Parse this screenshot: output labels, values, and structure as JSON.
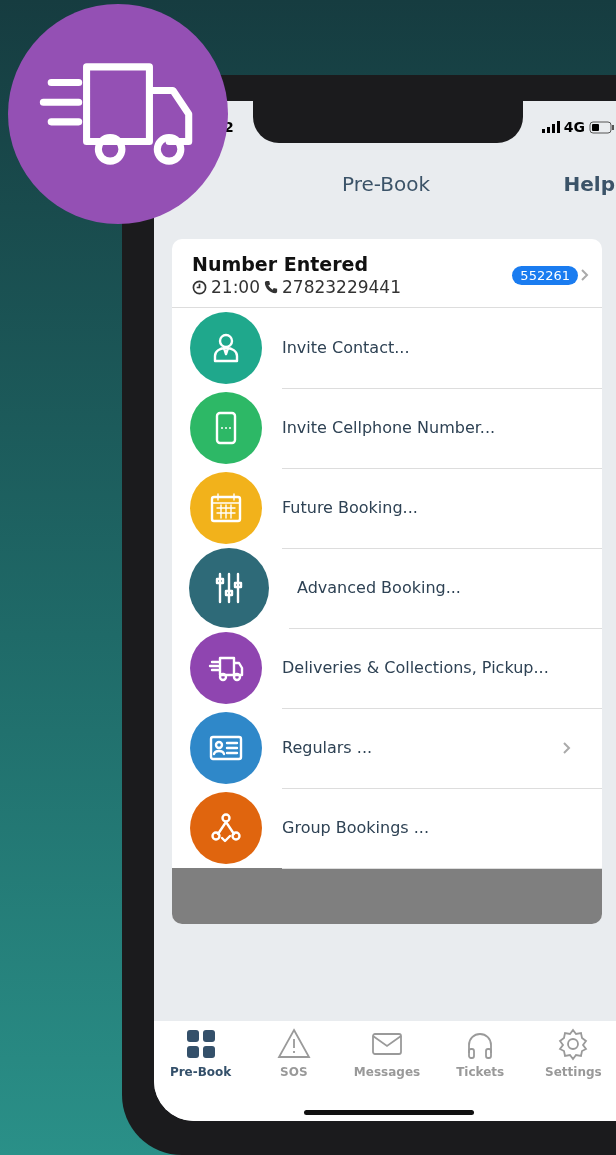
{
  "status_bar": {
    "time": "2",
    "network": "4G"
  },
  "nav_bar": {
    "title": "Pre-Book",
    "action": "Help"
  },
  "booking": {
    "title": "Number Entered",
    "time": "21:00",
    "phone": "27823229441",
    "badge": "552261"
  },
  "menu": [
    {
      "label": "Invite Contact...",
      "kind": "person",
      "color": "#1fa88c",
      "chevron": false
    },
    {
      "label": "Invite Cellphone Number...",
      "kind": "phone",
      "color": "#2db866",
      "chevron": false
    },
    {
      "label": "Future Booking...",
      "kind": "calendar",
      "color": "#f2b21b",
      "chevron": false
    },
    {
      "label": "Advanced Booking...",
      "kind": "sliders",
      "color": "#2e6a78",
      "chevron": false
    },
    {
      "label": "Deliveries & Collections, Pickup...",
      "kind": "truck",
      "color": "#8f45b0",
      "chevron": false
    },
    {
      "label": "Regulars ...",
      "kind": "card",
      "color": "#2f88c9",
      "chevron": true
    },
    {
      "label": "Group Bookings ...",
      "kind": "group",
      "color": "#e0650e",
      "chevron": false
    }
  ],
  "tabs": [
    {
      "label": "Pre-Book",
      "kind": "grid",
      "selected": true
    },
    {
      "label": "SOS",
      "kind": "warning",
      "selected": false
    },
    {
      "label": "Messages",
      "kind": "mail",
      "selected": false
    },
    {
      "label": "Tickets",
      "kind": "headphones",
      "selected": false
    },
    {
      "label": "Settings",
      "kind": "gear",
      "selected": false
    }
  ]
}
